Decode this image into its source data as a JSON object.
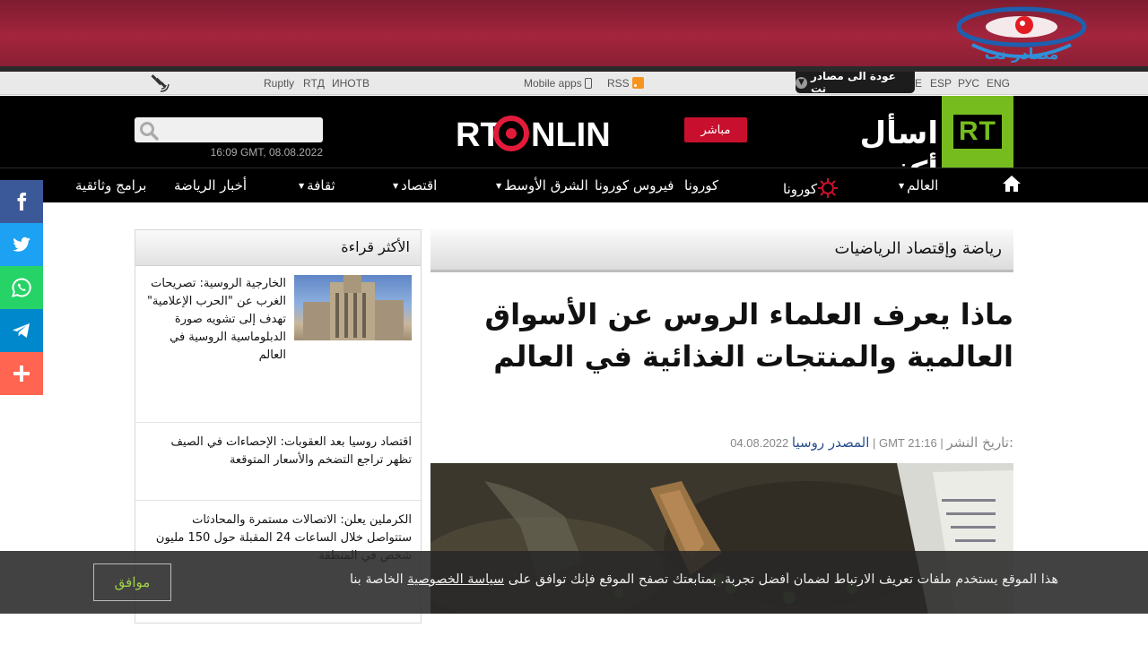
{
  "banner": {
    "logo_alt": "مصادر نت"
  },
  "util": {
    "links_left": [
      "Ruptly",
      "RTД",
      "ИНОТВ"
    ],
    "mobile_apps": "Mobile apps",
    "rss": "RSS",
    "back": "عودة الى مصادر نت",
    "langs": [
      "E",
      "ESP",
      "РУС",
      "ENG"
    ]
  },
  "header": {
    "date": "16:09 GMT, 08.08.2022",
    "live": "مباشر",
    "ask_more": "اسأل أكثر",
    "rt": "RT",
    "rt_online": "RTONLINE"
  },
  "nav": {
    "items": [
      "برامج وثائقية",
      "أخبار الرياضة",
      "ثقافة",
      "اقتصاد",
      "الشرق الأوسط",
      "فيروس كورونا",
      "كورونا",
      "العالم"
    ]
  },
  "section": {
    "title": "رياضة وإقتصاد الرياضيات"
  },
  "article": {
    "title": "ماذا يعرف العلماء الروس عن الأسواق العالمية والمنتجات الغذائية في العالم",
    "meta_time": "04.08.2022 | GMT 21:16 |",
    "author": "المصدر روسيا",
    "published": "تاريخ النشر:"
  },
  "side": {
    "title": "الأكثر قراءة",
    "items": [
      "الخارجية الروسية: تصريحات الغرب عن \"الحرب الإعلامية\" تهدف إلى تشويه صورة الدبلوماسية الروسية في العالم",
      "اقتصاد روسيا بعد العقوبات: الإحصاءات في الصيف تظهر تراجع التضخم والأسعار المتوقعة",
      "الكرملين يعلن: الاتصالات مستمرة والمحادثات ستتواصل خلال الساعات 24 المقبلة حول 150 مليون شخص في المنطقة"
    ]
  },
  "cookie": {
    "accept": "موافق",
    "text_before": "هذا الموقع يستخدم ملفات تعريف الارتباط لضمان أفضل تجربة. بمتابعتك تصفح الموقع فإنك توافق على",
    "link": "سياسة الخصوصية",
    "text_after": "الخاصة بنا"
  },
  "colors": {
    "banner": "#a3253d",
    "live": "#c8102e",
    "rt_green": "#77bc1f",
    "facebook": "#3b5998",
    "twitter": "#1da1f2",
    "whatsapp": "#25d366",
    "telegram": "#0088cc",
    "more": "#ff6550"
  }
}
